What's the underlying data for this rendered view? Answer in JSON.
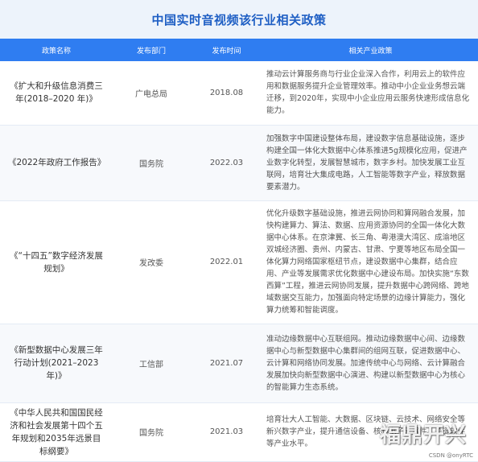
{
  "title": "中国实时音视频该行业相关政策",
  "headers": [
    "政策名称",
    "发布部门",
    "发布时间",
    "相关产业政策"
  ],
  "rows": [
    {
      "name": "《扩大和升级信息消费三年(2018–2020 年)》",
      "dept": "广电总局",
      "date": "2018.08",
      "policy": "推动云计算服务商与行业企业深入合作，利用云上的软件应用和数据服务提升企业管理效率。推动中小企业业务想云端迁移，到2020年，实现中小企业应用云服务快速形成信息化能力。"
    },
    {
      "name": "《2022年政府工作报告》",
      "dept": "国务院",
      "date": "2022.03",
      "policy": "加强数字中国建设整体布局，建设数字信息基础设施，逐步构建全国一体化大数据中心体系推进5g规模化应用，促进产业数字化转型，发展智慧城市，数字乡村。加快发展工业互联网，培育壮大集成电路，人工智能等数字产业，释放数据要素潜力。"
    },
    {
      "name": "《“十四五”数字经济发展规划》",
      "dept": "发改委",
      "date": "2022.01",
      "policy": "优化升级数字基础设施，推进云网协同和算网融合发展，加快构建算力、算法、数据、应用资源协同的全国一体化大数据中心体系。在京津冀、长三角、粤港澳大湾区、成渝地区双城经济圈、贵州、内蒙古、甘肃、宁夏等地区布局全国一体化算力网络国家枢纽节点，建设数据中心集群，结合应用、产业等发展需求优化数据中心建设布局。加快实施“东数西算”工程，推进云网协同发展，提升数据中心跨网络、跨地域数据交互能力，加强面向特定场景的边缘计算能力，强化算力统筹和智能调度。"
    },
    {
      "name": "《新型数据中心发展三年行动计划(2021–2023年)》",
      "dept": "工信部",
      "date": "2021.07",
      "policy": "准动边缘数据中心互联组网。推动边缘数据中心间、边缘数据中心与新型数据中心集群间的组网互联，促进数据中心、云计算和网络协同发展。加速传统中心与网络、云计算融合发展加快向新型数据中心演进、构建以新型数据中心为核心的智能算力生态系统。"
    },
    {
      "name": "《中华人民共和国国民经济和社会发展第十四个五年规划和2035年远景目标纲要》",
      "dept": "国务院",
      "date": "2021.03",
      "policy": "培育壮大人工智能、大数据、区块链、云技术、网络安全等新兴数字产业，提升通信设备、核心电子元器件、关键软件等产业水平。"
    }
  ],
  "watermark": "福鼎开兴",
  "credit": "CSDN @onyRTC"
}
